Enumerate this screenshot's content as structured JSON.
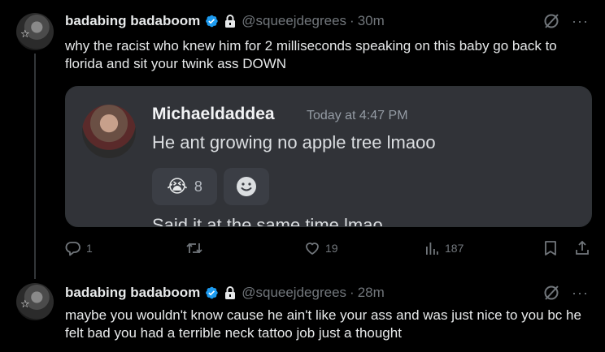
{
  "tweets": [
    {
      "display_name": "badabing badaboom",
      "handle": "@squeejdegrees",
      "separator": "·",
      "time": "30m",
      "text": "why the racist who knew him for 2 milliseconds speaking on this baby go back to florida and sit your twink ass DOWN",
      "embed": {
        "author": "Michaeldaddea",
        "timestamp": "Today at 4:47 PM",
        "message": "He ant growing no apple tree lmaoo",
        "reaction_emoji": "😭",
        "reaction_count": "8",
        "cutoff_message": "Said it at the same time lmao"
      },
      "actions": {
        "replies": "1",
        "retweets": "",
        "likes": "19",
        "views": "187"
      }
    },
    {
      "display_name": "badabing badaboom",
      "handle": "@squeejdegrees",
      "separator": "·",
      "time": "28m",
      "text": "maybe you wouldn't know cause he ain't like your ass and was just nice to you bc he felt bad you had a terrible neck tattoo job just a thought"
    }
  ],
  "icons": {
    "verified_color": "#1d9bf0",
    "avatar_star": "☆",
    "more": "···"
  }
}
